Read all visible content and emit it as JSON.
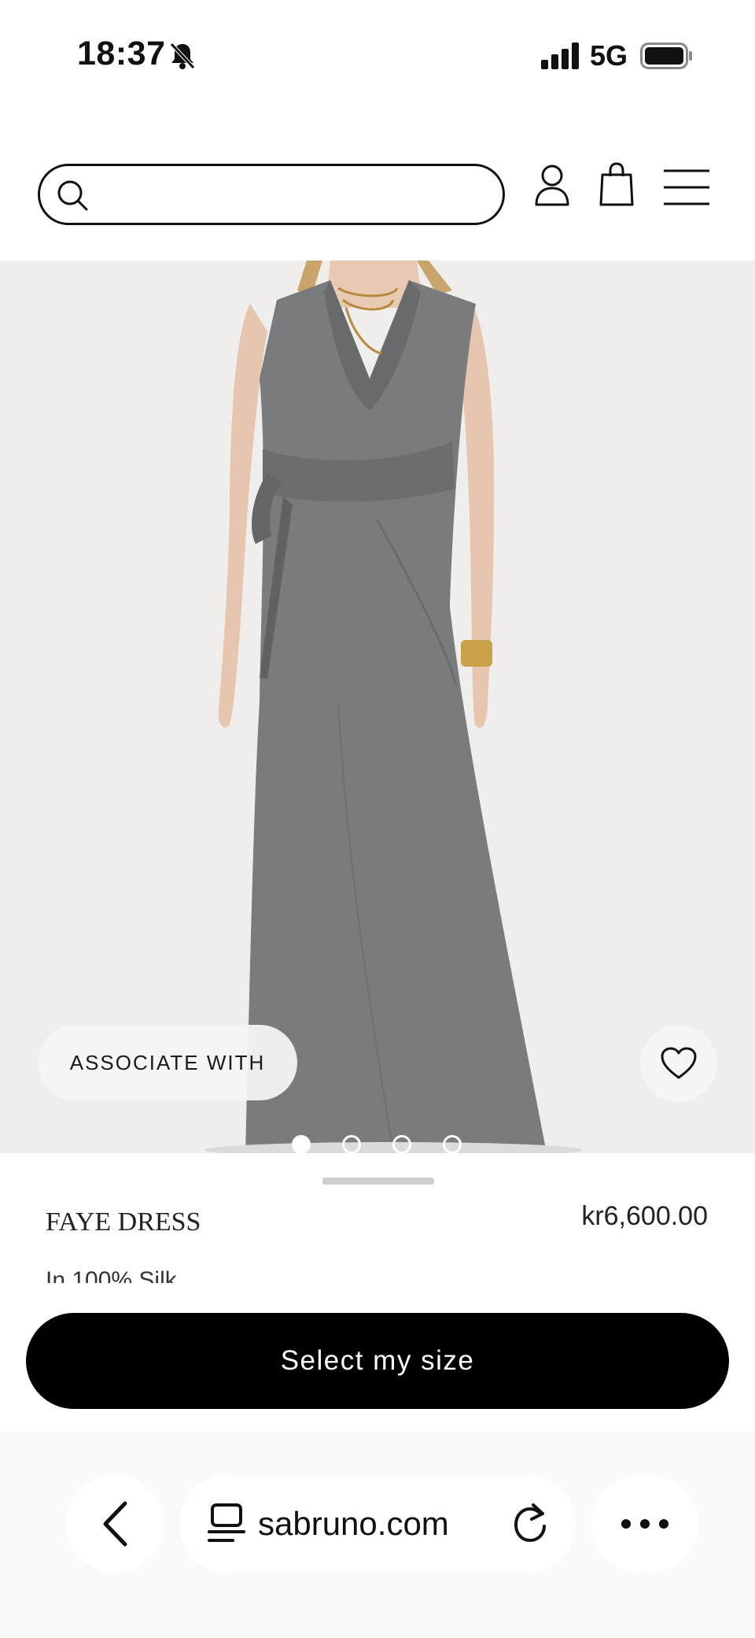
{
  "status_bar": {
    "time": "18:37",
    "network": "5G",
    "icons": [
      "bell-slash-icon",
      "signal-icon",
      "battery-icon"
    ]
  },
  "header": {
    "search": {
      "placeholder": "",
      "value": ""
    },
    "icons": [
      "search-icon",
      "account-icon",
      "bag-icon",
      "menu-icon"
    ]
  },
  "hero": {
    "associate_label": "ASSOCIATE WITH",
    "wishlist_icon": "heart-icon",
    "carousel": {
      "total": 4,
      "active_index": 0
    }
  },
  "product": {
    "name": "FAYE DRESS",
    "price": "kr6,600.00",
    "description_partial": "In 100% Silk"
  },
  "actions": {
    "select_size_label": "Select my size"
  },
  "browser": {
    "url": "sabruno.com",
    "icons": [
      "back-chevron-icon",
      "reader-icon",
      "reload-icon",
      "more-icon"
    ]
  },
  "colors": {
    "dress": "#767779",
    "hero_background": "#efeeed",
    "button_background": "#000000"
  }
}
